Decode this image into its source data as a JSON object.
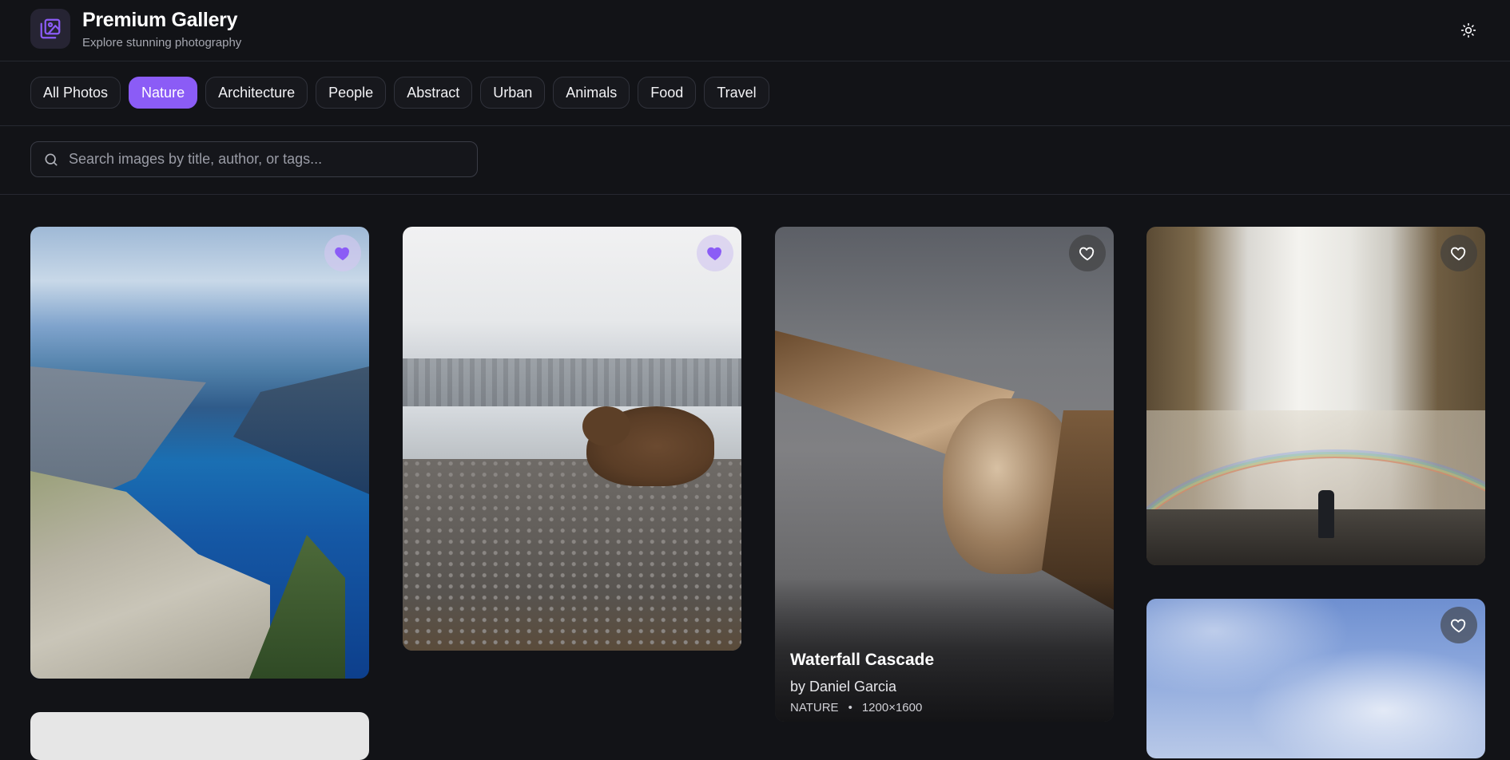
{
  "header": {
    "title": "Premium Gallery",
    "subtitle": "Explore stunning photography"
  },
  "categories": {
    "active": "Nature",
    "items": [
      "All Photos",
      "Nature",
      "Architecture",
      "People",
      "Abstract",
      "Urban",
      "Animals",
      "Food",
      "Travel"
    ]
  },
  "search": {
    "placeholder": "Search images by title, author, or tags...",
    "value": ""
  },
  "gallery": {
    "cards": [
      {
        "favorited": true
      },
      {
        "favorited": true
      },
      {
        "favorited": false,
        "title": "Waterfall Cascade",
        "author": "by Daniel Garcia",
        "category": "NATURE",
        "dimensions": "1200×1600"
      },
      {
        "favorited": false
      },
      {
        "favorited": false
      }
    ]
  },
  "colors": {
    "accent": "#8b5cf6",
    "background": "#121317"
  }
}
